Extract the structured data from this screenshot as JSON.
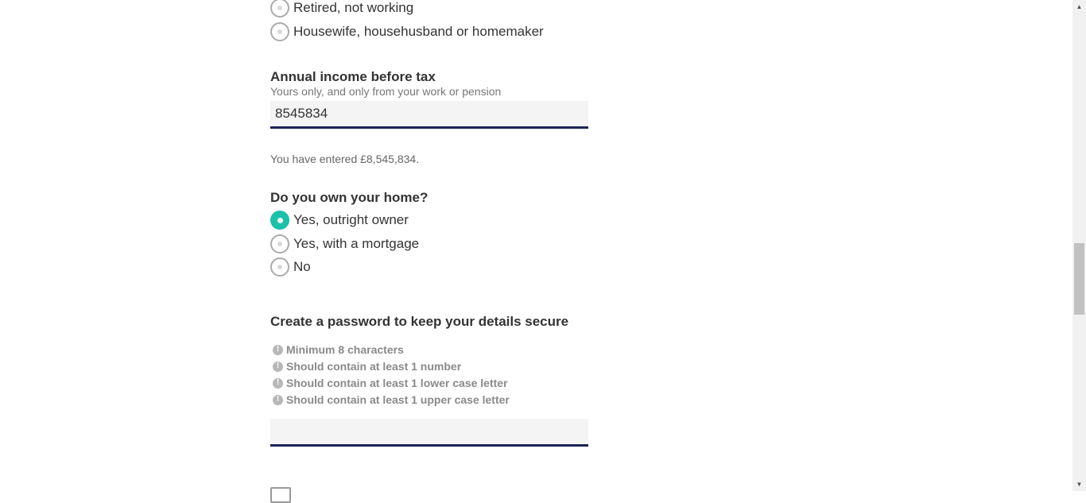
{
  "employment": {
    "options": [
      {
        "label": "Retired, not working",
        "checked": false
      },
      {
        "label": "Housewife, househusband or homemaker",
        "checked": false
      }
    ]
  },
  "income": {
    "heading": "Annual income before tax",
    "hint": "Yours only, and only from your work or pension",
    "value": "8545834",
    "confirmation": "You have entered £8,545,834."
  },
  "home": {
    "heading": "Do you own your home?",
    "options": [
      {
        "label": "Yes, outright owner",
        "checked": true
      },
      {
        "label": "Yes, with a mortgage",
        "checked": false
      },
      {
        "label": "No",
        "checked": false
      }
    ]
  },
  "password": {
    "heading": "Create a password to keep your details secure",
    "rules": [
      "Minimum 8 characters",
      "Should contain at least 1 number",
      "Should contain at least 1 lower case letter",
      "Should contain at least 1 upper case letter"
    ],
    "value": "",
    "rule_icon": "exclamation-info-icon"
  },
  "colors": {
    "accent": "#1bc1a8",
    "input_underline": "#1c2257",
    "input_background": "#f4f4f4"
  }
}
